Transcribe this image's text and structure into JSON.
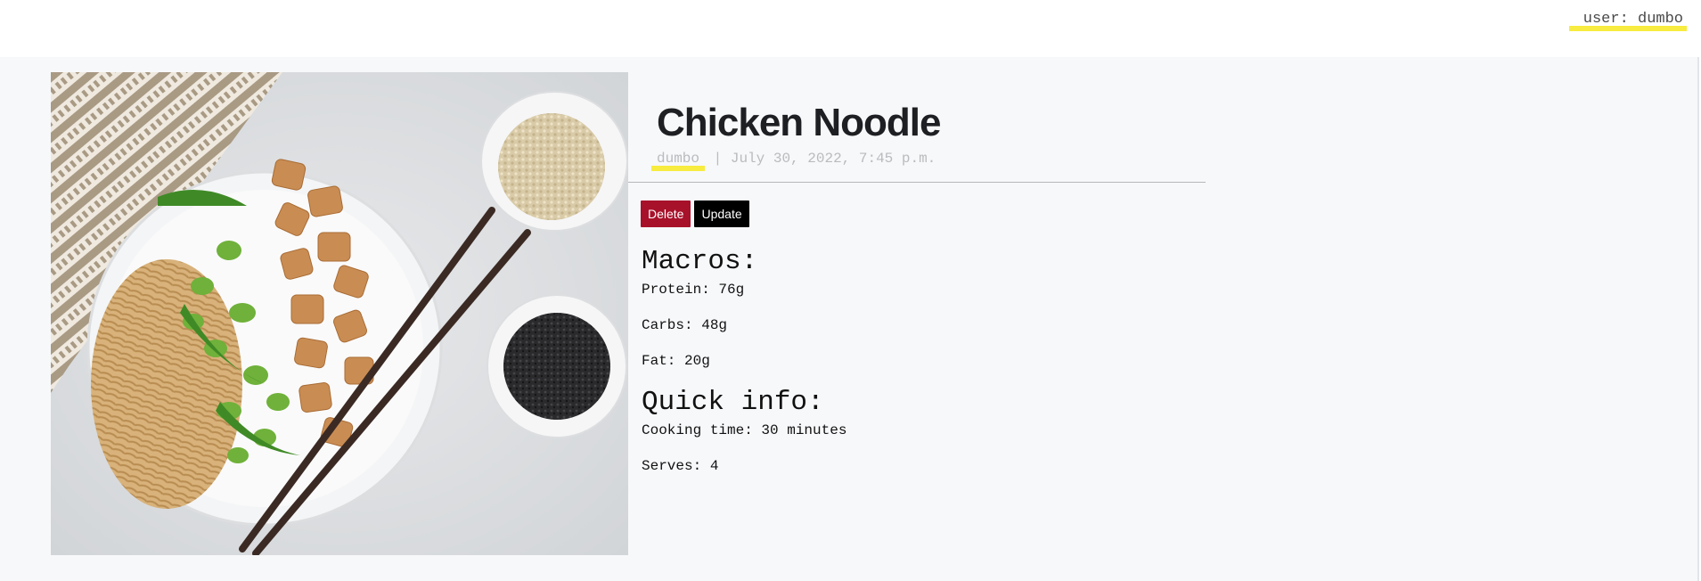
{
  "header": {
    "user_label": "user: dumbo"
  },
  "recipe": {
    "title": "Chicken Noodle",
    "author": "dumbo",
    "separator": "|",
    "date": "July 30, 2022, 7:45 p.m.",
    "actions": {
      "delete_label": "Delete",
      "update_label": "Update"
    },
    "macros": {
      "heading": "Macros:",
      "protein": "Protein: 76g",
      "carbs": "Carbs: 48g",
      "fat": "Fat: 20g"
    },
    "quick_info": {
      "heading": "Quick info:",
      "cooking_time": "Cooking time: 30 minutes",
      "serves": "Serves: 4"
    }
  },
  "colors": {
    "accent_highlight": "#f7ec3f",
    "delete_button": "#a8112a",
    "update_button": "#000000",
    "page_background": "#f7f8fa"
  }
}
